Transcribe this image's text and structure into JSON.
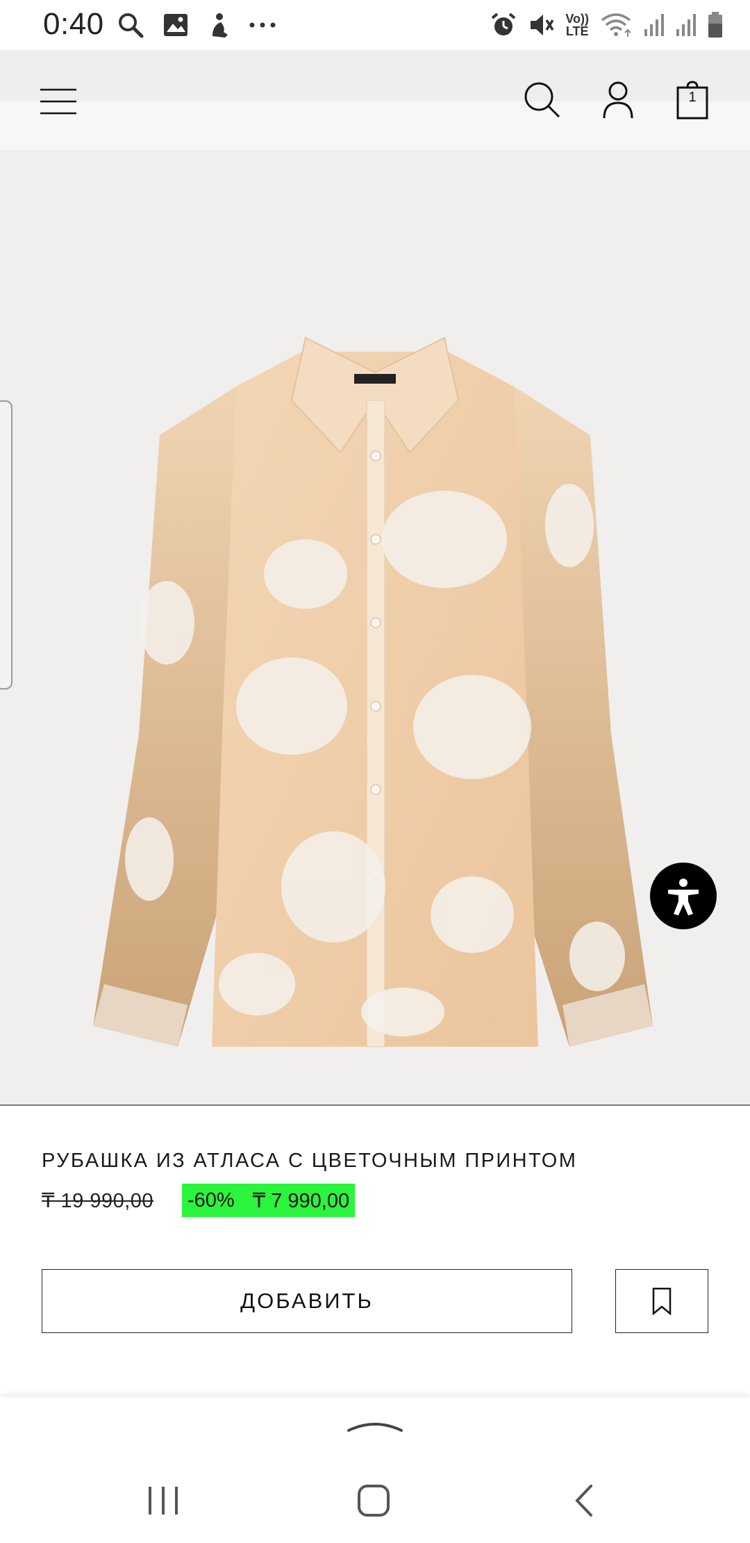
{
  "status_bar": {
    "time": "0:40",
    "left_icons": [
      "search-icon",
      "gallery-icon",
      "app-notification-icon",
      "more-notifications-icon"
    ],
    "volte_label_top": "Vo))",
    "volte_label_bottom": "LTE",
    "right_icons": [
      "alarm-icon",
      "mute-icon",
      "volte-icon",
      "wifi-icon",
      "signal-icon",
      "signal-icon",
      "battery-icon"
    ]
  },
  "header": {
    "icons": [
      "menu-icon",
      "search-icon",
      "account-icon",
      "shopping-bag-icon"
    ],
    "cart_count": "1"
  },
  "product": {
    "image_alt": "Рубашка из атласа с цветочным принтом",
    "title": "РУБАШКА ИЗ АТЛАСА С ЦВЕТОЧНЫМ ПРИНТОМ",
    "old_price": "₸ 19 990,00",
    "discount": "-60%",
    "sale_price": "₸ 7 990,00",
    "add_button_label": "ДОБАВИТЬ",
    "bookmark_icon": "bookmark-icon",
    "accessibility_icon": "accessibility-icon"
  },
  "colors": {
    "sale_badge": "#2bf43c",
    "image_background": "#f0efee"
  },
  "nav_bar": {
    "icons": [
      "recent-apps-icon",
      "home-icon",
      "back-icon"
    ],
    "sheet_handle_icon": "chevron-up-icon"
  }
}
